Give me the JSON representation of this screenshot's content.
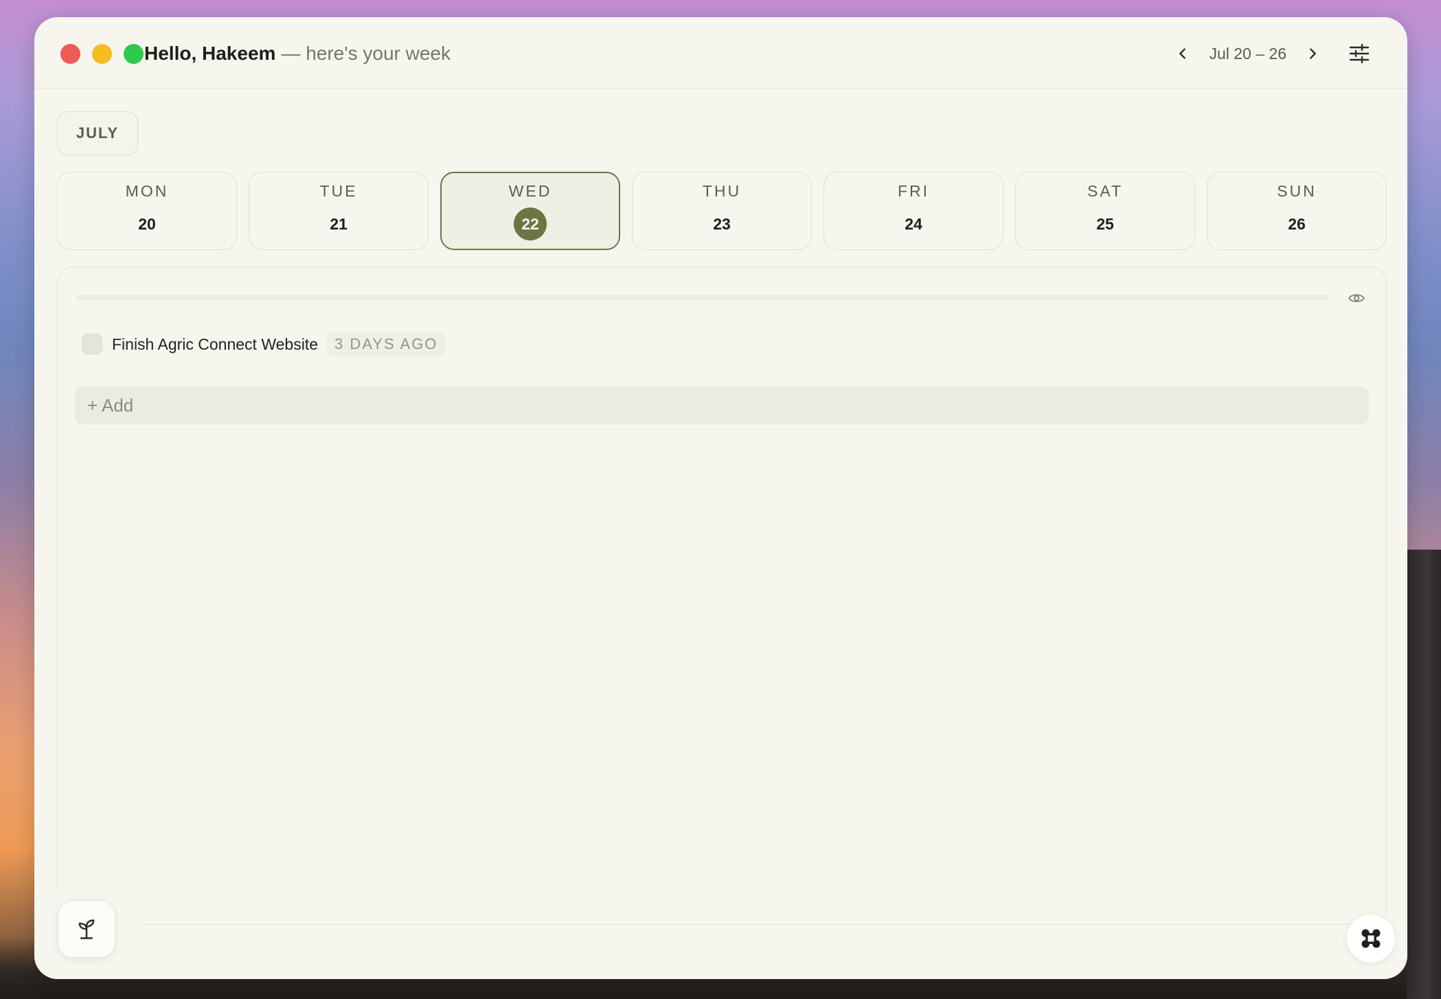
{
  "header": {
    "greeting": "Hello, Hakeem",
    "subtitle": "— here's your week",
    "week_range": "Jul 20 – 26",
    "prev_icon": "chevron-left-icon",
    "next_icon": "chevron-right-icon",
    "settings_icon": "sliders-icon"
  },
  "month": "JULY",
  "days": [
    {
      "name": "MON",
      "date": "20",
      "selected": false
    },
    {
      "name": "TUE",
      "date": "21",
      "selected": false
    },
    {
      "name": "WED",
      "date": "22",
      "selected": true
    },
    {
      "name": "THU",
      "date": "23",
      "selected": false
    },
    {
      "name": "FRI",
      "date": "24",
      "selected": false
    },
    {
      "name": "SAT",
      "date": "25",
      "selected": false
    },
    {
      "name": "SUN",
      "date": "26",
      "selected": false
    }
  ],
  "panel": {
    "progress": 0,
    "visibility_icon": "eye-icon",
    "tasks": [
      {
        "title": "Finish Agric Connect Website",
        "badge": "3 DAYS AGO",
        "done": false
      }
    ],
    "add_label": "+ Add"
  },
  "footer": {
    "left_icon": "sprout-icon",
    "right_icon": "command-icon"
  },
  "colors": {
    "accent": "#6c7645",
    "background": "#f6f5ee"
  }
}
